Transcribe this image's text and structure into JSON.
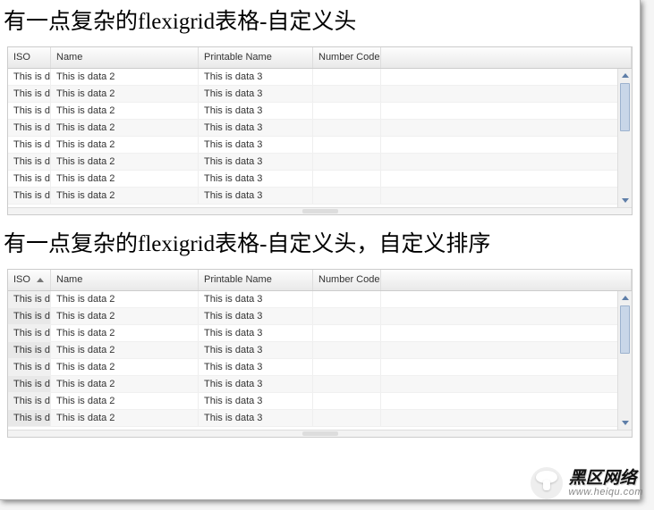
{
  "titles": {
    "grid1": "有一点复杂的flexigrid表格-自定义头",
    "grid2": "有一点复杂的flexigrid表格-自定义头，自定义排序"
  },
  "columns": {
    "iso": "ISO",
    "name": "Name",
    "printable": "Printable Name",
    "number_code": "Number Code"
  },
  "grid1": {
    "rows": [
      {
        "iso": "This is da",
        "name": "This is data 2",
        "printable": "This is data 3",
        "num": ""
      },
      {
        "iso": "This is da",
        "name": "This is data 2",
        "printable": "This is data 3",
        "num": ""
      },
      {
        "iso": "This is da",
        "name": "This is data 2",
        "printable": "This is data 3",
        "num": ""
      },
      {
        "iso": "This is da",
        "name": "This is data 2",
        "printable": "This is data 3",
        "num": ""
      },
      {
        "iso": "This is da",
        "name": "This is data 2",
        "printable": "This is data 3",
        "num": ""
      },
      {
        "iso": "This is da",
        "name": "This is data 2",
        "printable": "This is data 3",
        "num": ""
      },
      {
        "iso": "This is da",
        "name": "This is data 2",
        "printable": "This is data 3",
        "num": ""
      },
      {
        "iso": "This is da",
        "name": "This is data 2",
        "printable": "This is data 3",
        "num": ""
      }
    ]
  },
  "grid2": {
    "sort_column": "iso",
    "sort_dir": "asc",
    "rows": [
      {
        "iso": "This is da",
        "name": "This is data 2",
        "printable": "This is data 3",
        "num": ""
      },
      {
        "iso": "This is da",
        "name": "This is data 2",
        "printable": "This is data 3",
        "num": ""
      },
      {
        "iso": "This is da",
        "name": "This is data 2",
        "printable": "This is data 3",
        "num": ""
      },
      {
        "iso": "This is da",
        "name": "This is data 2",
        "printable": "This is data 3",
        "num": ""
      },
      {
        "iso": "This is da",
        "name": "This is data 2",
        "printable": "This is data 3",
        "num": ""
      },
      {
        "iso": "This is da",
        "name": "This is data 2",
        "printable": "This is data 3",
        "num": ""
      },
      {
        "iso": "This is da",
        "name": "This is data 2",
        "printable": "This is data 3",
        "num": ""
      },
      {
        "iso": "This is da",
        "name": "This is data 2",
        "printable": "This is data 3",
        "num": ""
      }
    ]
  },
  "branding": {
    "name": "黑区网络",
    "domain": "www.heiqu.com"
  }
}
